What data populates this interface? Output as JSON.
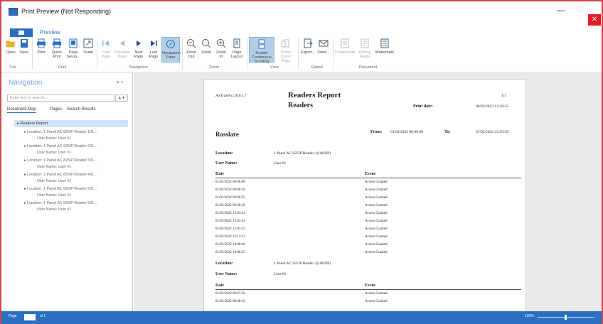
{
  "window": {
    "title": "Print Preview (Not Responding)",
    "minimize": "—",
    "maximize": "☐",
    "close": "✕"
  },
  "ribbon_tabs": {
    "preview_label": "Preview"
  },
  "ribbon": {
    "groups": {
      "file": "File",
      "print": "Print",
      "navigation": "Navigation",
      "zoom": "Zoom",
      "view": "View",
      "export": "Export",
      "document": "Document"
    },
    "buttons": {
      "open": "Open",
      "save": "Save",
      "print": "Print",
      "quick_print": "Quick Print",
      "page_setup": "Page Setup...",
      "scale": "Scale",
      "first_page": "First Page",
      "previous_page": "Previous Page",
      "next_page": "Next Page",
      "last_page": "Last Page",
      "navigation_pane": "Navigation Pane",
      "zoom_out": "Zoom Out",
      "zoom": "Zoom",
      "zoom_in": "Zoom In",
      "page_layout": "Page Layout",
      "continuous_scrolling": "Enable Continuous Scrolling",
      "show_cover_page": "Show Cover Page",
      "export": "Export...",
      "send": "Send...",
      "parameters": "Parameters",
      "editing_fields": "Editing Fields",
      "watermark": "Watermark"
    }
  },
  "navigation": {
    "title": "Navigation",
    "pins": "▾ ×",
    "search_placeholder": "Enter text to search...",
    "search_button": "▲▼",
    "tabs": {
      "document_map": "Document Map",
      "pages": "Pages",
      "search_results": "Search Results"
    },
    "tree_root": "▸ Readers Report",
    "tree_items": [
      {
        "location": "▸ Location: 1 Panel AC 825IP Reader 101...",
        "user": "User Name: User #1"
      },
      {
        "location": "▸ Location: 1 Panel AC 825IP Reader 201...",
        "user": "User Name: User #1"
      },
      {
        "location": "▸ Location: 1 Panel AC 825IP Reader 301...",
        "user": "User Name: User #1"
      },
      {
        "location": "▸ Location: 1 Panel AC 825IP Reader 401...",
        "user": "User Name: User #1"
      },
      {
        "location": "▸ Location: 1 Panel AC 825IP Reader 501...",
        "user": "User Name: User #1"
      },
      {
        "location": "▸ Location: 1 Panel AC 825IP Reader 601...",
        "user": "User Name: User #1"
      }
    ]
  },
  "report": {
    "version": "AxTraxPro 28.0.1.7",
    "title": "Readers Report",
    "subtitle": "Readers",
    "page_number": "1/1",
    "print_date_label": "Print date:",
    "print_date_value": "08/03/2022 13:28:55",
    "site": "Rosslare",
    "from_label": "From:",
    "from_value": "01/03/2022 00:00:00",
    "to_label": "To:",
    "to_value": "07/03/2022 23:59:59",
    "sections": [
      {
        "location_label": "Location:",
        "location_value": "1 Panel AC 825IP Reader 1(1002IP)",
        "user_label": "User Name:",
        "user_value": "User #1",
        "date_header": "Date",
        "event_header": "Event",
        "rows": [
          {
            "date": "01/03/2022 08:08:08",
            "event": "Access Granted"
          },
          {
            "date": "01/03/2022 08:08:16",
            "event": "Access Granted"
          },
          {
            "date": "01/03/2022 09:08:25",
            "event": "Access Granted"
          },
          {
            "date": "01/03/2022 09:28:18",
            "event": "Access Granted"
          },
          {
            "date": "01/03/2022 12:03:24",
            "event": "Access Granted"
          },
          {
            "date": "01/03/2022 12:03:43",
            "event": "Access Granted"
          },
          {
            "date": "01/03/2022 12:03:55",
            "event": "Access Granted"
          },
          {
            "date": "01/03/2022 12:12:33",
            "event": "Access Granted"
          },
          {
            "date": "01/03/2022 14:08:48",
            "event": "Access Granted"
          },
          {
            "date": "01/03/2022 16:08:25",
            "event": "Access Granted"
          }
        ]
      },
      {
        "location_label": "Location:",
        "location_value": "1 Panel AC 825IP Reader 2(1002IP)",
        "user_label": "User Name:",
        "user_value": "User #1",
        "date_header": "Date",
        "event_header": "Event",
        "rows": [
          {
            "date": "01/03/2022 08:07:58",
            "event": "Access Granted"
          },
          {
            "date": "01/03/2022 08:08:16",
            "event": "Access Granted"
          }
        ]
      }
    ]
  },
  "statusbar": {
    "page_label": "Page",
    "page_total": "of 1",
    "zoom_label": "100%"
  },
  "colors": {
    "accent": "#2b6fc2",
    "frame_border": "#d6414f",
    "close_button": "#e51d25",
    "active_button": "#b3cfe8"
  }
}
